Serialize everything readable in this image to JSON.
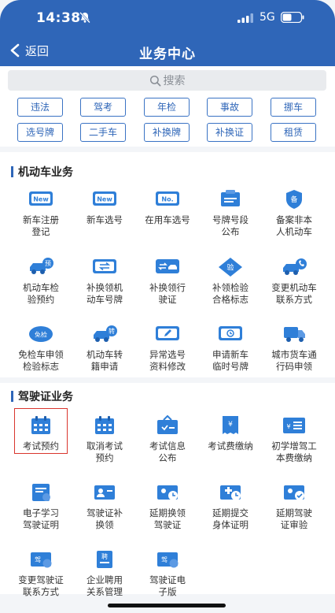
{
  "status": {
    "time": "14:38",
    "network": "5G"
  },
  "nav": {
    "back_label": "返回",
    "title": "业务中心"
  },
  "search": {
    "placeholder": "搜索"
  },
  "quick": [
    "违法",
    "驾考",
    "年检",
    "事故",
    "挪车",
    "选号牌",
    "二手车",
    "补换牌",
    "补换证",
    "租赁"
  ],
  "vehicle": {
    "title": "机动车业务",
    "items": [
      {
        "label": "新车注册\n登记",
        "icon": "new-badge-icon"
      },
      {
        "label": "新车选号",
        "icon": "new-badge-icon"
      },
      {
        "label": "在用车选号",
        "icon": "number-plate-icon"
      },
      {
        "label": "号牌号段\n公布",
        "icon": "plate-announce-icon"
      },
      {
        "label": "备案非本\n人机动车",
        "icon": "filing-shield-icon"
      },
      {
        "label": "机动车检\n验预约",
        "icon": "car-inspection-icon"
      },
      {
        "label": "补换领机\n动车号牌",
        "icon": "plate-exchange-icon"
      },
      {
        "label": "补换领行\n驶证",
        "icon": "license-exchange-icon"
      },
      {
        "label": "补领检验\n合格标志",
        "icon": "inspection-mark-icon"
      },
      {
        "label": "变更机动车\n联系方式",
        "icon": "car-phone-icon"
      },
      {
        "label": "免检车申领\n检验标志",
        "icon": "exempt-badge-icon"
      },
      {
        "label": "机动车转\n籍申请",
        "icon": "car-transfer-icon"
      },
      {
        "label": "异常选号\n资料修改",
        "icon": "edit-plate-icon"
      },
      {
        "label": "申请新车\n临时号牌",
        "icon": "temp-plate-icon"
      },
      {
        "label": "城市货车通\n行码申领",
        "icon": "truck-icon"
      }
    ]
  },
  "license": {
    "title": "驾驶证业务",
    "items": [
      {
        "label": "考试预约",
        "icon": "calendar-icon"
      },
      {
        "label": "取消考试\n预约",
        "icon": "calendar-icon"
      },
      {
        "label": "考试信息\n公布",
        "icon": "exam-info-icon"
      },
      {
        "label": "考试费缴纳",
        "icon": "fee-receipt-icon"
      },
      {
        "label": "初学增驾工\n本费缴纳",
        "icon": "fee-list-icon"
      },
      {
        "label": "电子学习\n驾驶证明",
        "icon": "study-cert-icon"
      },
      {
        "label": "驾驶证补\n换领",
        "icon": "license-user-icon"
      },
      {
        "label": "延期换领\n驾驶证",
        "icon": "license-clock-icon"
      },
      {
        "label": "延期提交\n身体证明",
        "icon": "medical-cert-icon"
      },
      {
        "label": "延期驾驶\n证审验",
        "icon": "license-check-icon"
      },
      {
        "label": "变更驾驶证\n联系方式",
        "icon": "license-phone-icon"
      },
      {
        "label": "企业聘用\n关系管理",
        "icon": "hire-doc-icon"
      },
      {
        "label": "驾驶证电\n子版",
        "icon": "e-license-icon"
      }
    ]
  }
}
